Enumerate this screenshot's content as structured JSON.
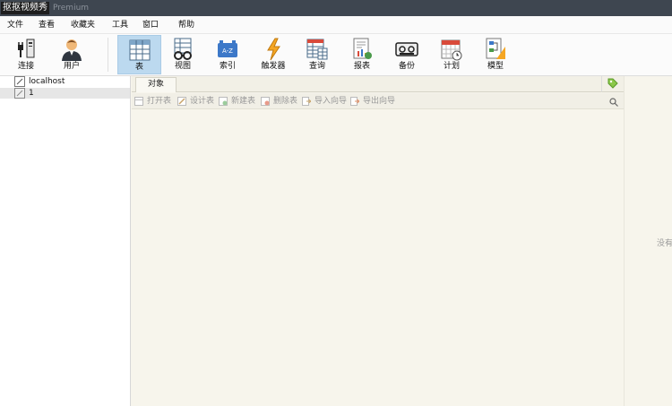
{
  "titlebar": {
    "title": "抠抠视频秀",
    "edition": "Premium"
  },
  "menu": [
    "文件",
    "查看",
    "收藏夹",
    "工具",
    "窗口",
    "帮助"
  ],
  "toolbar": {
    "connect": "连接",
    "user": "用户",
    "table": "表",
    "view": "视图",
    "index": "索引",
    "trigger": "触发器",
    "query": "查询",
    "report": "报表",
    "backup": "备份",
    "schedule": "计划",
    "model": "模型"
  },
  "tree": {
    "host": "localhost",
    "db": "1"
  },
  "tabs": {
    "objects": "对象"
  },
  "actions": {
    "open": "打开表",
    "design": "设计表",
    "new": "新建表",
    "delete": "删除表",
    "import": "导入向导",
    "export": "导出向导"
  },
  "status": {
    "right_pane": "没有"
  },
  "colors": {
    "titlebar": "#3e4650",
    "active_tool": "#bcd9ef",
    "content_bg": "#f7f5ec"
  }
}
